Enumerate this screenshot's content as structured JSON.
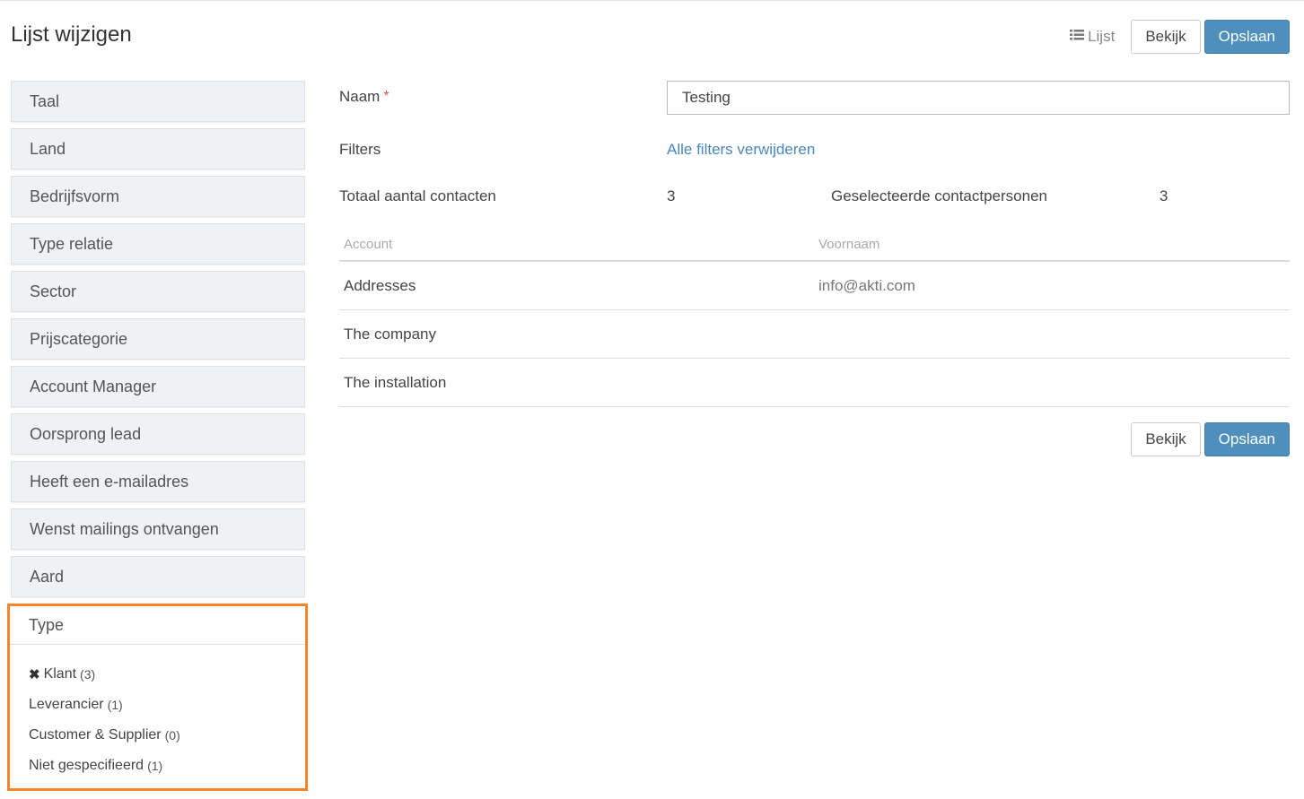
{
  "header": {
    "title": "Lijst wijzigen",
    "list_link_label": "Lijst",
    "list_icon": "list-icon",
    "view_label": "Bekijk",
    "save_label": "Opslaan"
  },
  "sidebar": {
    "filters": [
      {
        "label": "Taal"
      },
      {
        "label": "Land"
      },
      {
        "label": "Bedrijfsvorm"
      },
      {
        "label": "Type relatie"
      },
      {
        "label": "Sector"
      },
      {
        "label": "Prijscategorie"
      },
      {
        "label": "Account Manager"
      },
      {
        "label": "Oorsprong lead"
      },
      {
        "label": "Heeft een e-mailadres"
      },
      {
        "label": "Wenst mailings ontvangen"
      },
      {
        "label": "Aard"
      }
    ],
    "type_panel": {
      "title": "Type",
      "options": [
        {
          "label": "Klant",
          "count": "(3)",
          "selected": true
        },
        {
          "label": "Leverancier",
          "count": "(1)",
          "selected": false
        },
        {
          "label": "Customer & Supplier",
          "count": "(0)",
          "selected": false
        },
        {
          "label": "Niet gespecifieerd",
          "count": "(1)",
          "selected": false
        }
      ]
    }
  },
  "form": {
    "name_label": "Naam",
    "required_mark": "*",
    "name_value": "Testing",
    "filters_label": "Filters",
    "remove_filters_link": "Alle filters verwijderen",
    "total_contacts_label": "Totaal aantal contacten",
    "total_contacts_value": "3",
    "selected_contacts_label": "Geselecteerde contactpersonen",
    "selected_contacts_value": "3"
  },
  "table": {
    "columns": [
      "Account",
      "Voornaam"
    ],
    "rows": [
      [
        "Addresses",
        "info@akti.com"
      ],
      [
        "The company",
        ""
      ],
      [
        "The installation",
        ""
      ]
    ]
  },
  "footer": {
    "view_label": "Bekijk",
    "save_label": "Opslaan"
  },
  "colors": {
    "primary": "#4f8fbd",
    "link": "#4a86b8",
    "highlight": "#f5852a",
    "required": "#d9534f"
  }
}
